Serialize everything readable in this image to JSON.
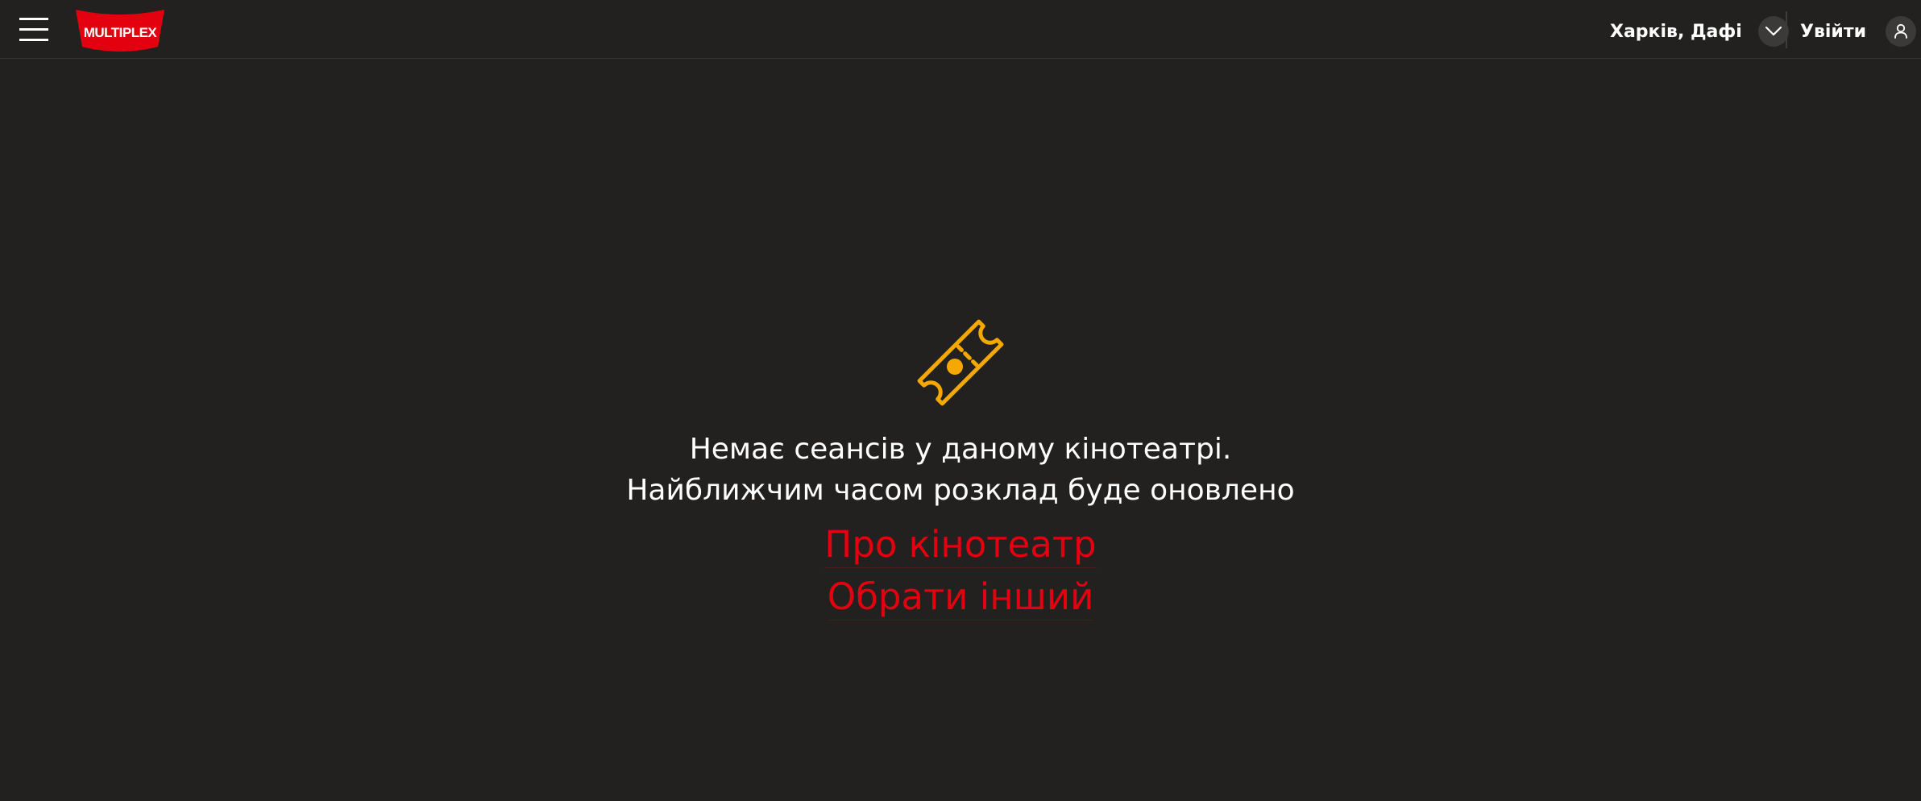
{
  "header": {
    "menu_icon": "hamburger-menu-icon",
    "logo": {
      "text": "MULTIPLEX",
      "color": "#e3000f"
    },
    "location": {
      "label": "Харків, Дафі",
      "icon": "chevron-down-icon"
    },
    "login": {
      "label": "Увійти",
      "icon": "user-icon"
    }
  },
  "main": {
    "icon": "ticket-icon",
    "icon_color": "#f5a800",
    "message_line1": "Немає сеансів у даному кінотеатрі.",
    "message_line2": "Найближчим часом розклад буде оновлено",
    "links": {
      "about": "Про кінотеатр",
      "choose_other": "Обрати інший"
    },
    "link_color": "#e3000f"
  }
}
